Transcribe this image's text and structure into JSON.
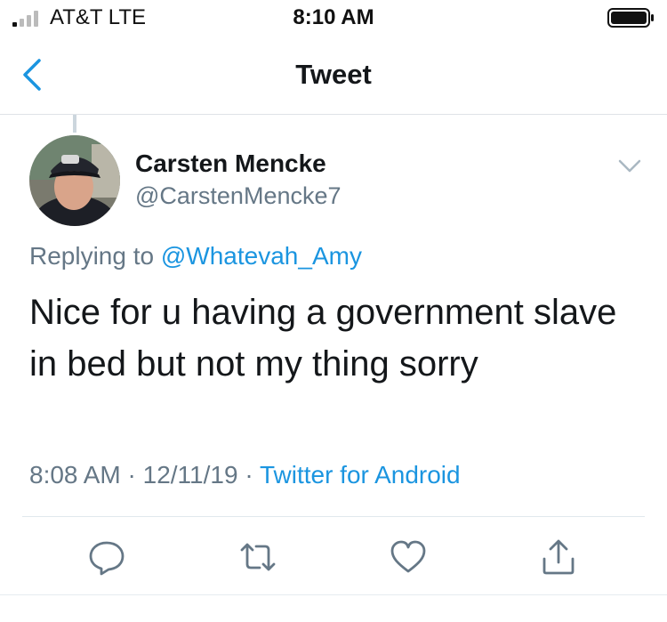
{
  "status_bar": {
    "carrier": "AT&T   LTE",
    "time": "8:10 AM"
  },
  "nav": {
    "title": "Tweet"
  },
  "tweet": {
    "author_name": "Carsten Mencke",
    "author_handle": "@CarstenMencke7",
    "replying_prefix": "Replying to",
    "replying_to": "@Whatevah_Amy",
    "text": "Nice for u having a government slave in bed but not my thing sorry",
    "time": "8:08 AM",
    "sep1": "·",
    "date": "12/11/19",
    "sep2": "·",
    "source": "Twitter for Android"
  },
  "actions": {
    "icons": [
      "reply-icon",
      "retweet-icon",
      "like-icon",
      "share-icon"
    ]
  },
  "colors": {
    "accent": "#1b95e0",
    "secondary_text": "#657786",
    "primary_text": "#14171a",
    "divider": "#e1e8ed"
  }
}
